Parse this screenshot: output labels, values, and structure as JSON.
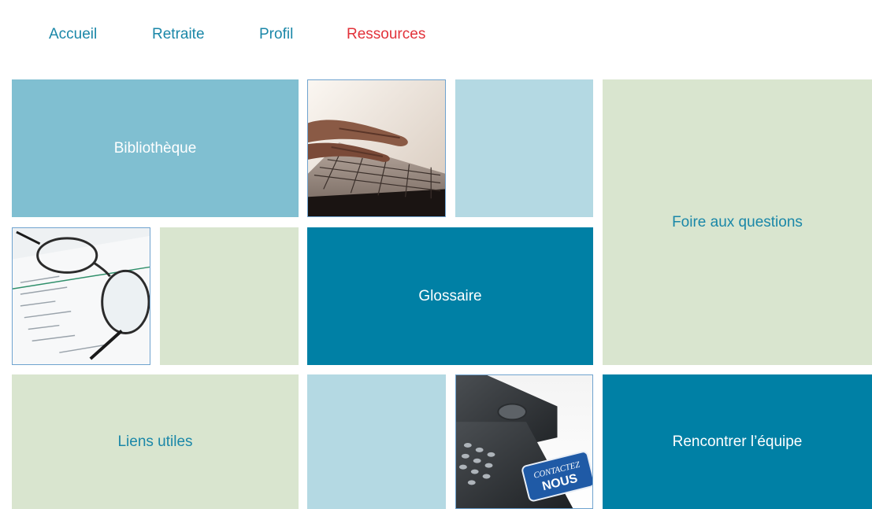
{
  "nav": {
    "items": [
      {
        "label": "Accueil",
        "active": false
      },
      {
        "label": "Retraite",
        "active": false
      },
      {
        "label": "Profil",
        "active": false
      },
      {
        "label": "Ressources",
        "active": true
      }
    ]
  },
  "tiles": {
    "bibliotheque": "Bibliothèque",
    "faq": "Foire aux questions",
    "glossaire": "Glossaire",
    "liens": "Liens utiles",
    "equipe": "Rencontrer l’équipe"
  },
  "images": {
    "phone_sign_line1": "CONTACTEZ",
    "phone_sign_line2": "NOUS"
  },
  "colors": {
    "nav_link": "#1a87a8",
    "nav_active": "#e2323a",
    "tile_medium": "#80bfd1",
    "tile_light": "#b4d9e3",
    "tile_green": "#d9e5cf",
    "tile_dark": "#0080a5"
  }
}
